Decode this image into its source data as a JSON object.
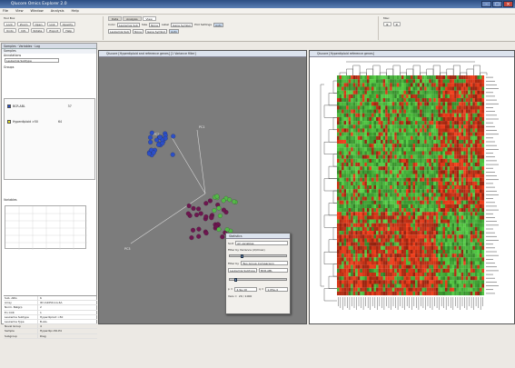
{
  "app": {
    "title": "Qlucore Omics Explorer 2.0"
  },
  "menu": [
    "File",
    "View",
    "Window",
    "Analysis",
    "Help"
  ],
  "toolbar": {
    "group1_label": "Tool Box",
    "buttons_row1": [
      "Lock",
      "Zoom",
      "Open",
      "Link",
      "Opacity"
    ],
    "buttons_row2": [
      "Undo",
      "Info",
      "Rotate",
      "Export",
      "Help"
    ],
    "tabs": [
      "Data",
      "Analysis",
      "View"
    ],
    "color_label": "Color",
    "color_value": "Leukemia Sub",
    "size_label": "Size",
    "size_value": "None",
    "label_label": "Label",
    "label_value": "Gene Symbol",
    "plot_label": "Plot Settings",
    "plot_value": "Auto",
    "misc_label": "Misc"
  },
  "left_panel": {
    "title": "Samples",
    "tabs": [
      "Samples",
      "Variables",
      "Log"
    ],
    "annotations_label": "Annotations",
    "annotation_value": "Leukemia Subtype",
    "legend_label": "Groups",
    "legend": [
      {
        "label": "BCR-ABL",
        "count": "37",
        "color": "#2850c8"
      },
      {
        "label": "Hyperdiploid >50",
        "count": "64",
        "color": "#e0e020"
      }
    ],
    "variables_label": "Variables",
    "properties": [
      [
        "Sub. ARG",
        "6"
      ],
      [
        "Array",
        "ID=A2050-1A-6A"
      ],
      [
        "Norm. Batgrp",
        "2"
      ],
      [
        "En CCR",
        "1"
      ],
      [
        "Leukemia Subtype",
        "Hyperdiploid >50"
      ],
      [
        "Leukemia Type",
        "B-ALL"
      ],
      [
        "Novel Group",
        "4"
      ],
      [
        "Sample",
        "Hyperdip>50-P4"
      ],
      [
        "Subgroup",
        "Diag"
      ]
    ]
  },
  "pca_window": {
    "title": "Qlucore [Hyperdiploid and reference genes] [1 Variance filter]",
    "axis_labels": [
      "PC1",
      "PC2",
      "PC3"
    ]
  },
  "heatmap_window": {
    "title": "Qlucore [Hyperdiploid reference genes]"
  },
  "filter_dialog": {
    "title": "Statistics",
    "sort_label": "Sort",
    "sort_value": "All variables",
    "filter1_label": "Filter by Variance (σ/σmax)",
    "filter2_label": "Filter by",
    "filter2_value": "Two Group Comparison",
    "group_a": "Leukemia Subtype",
    "group_b": "BCR-ABL",
    "p_label": "p =",
    "p_value": "4.9e-10",
    "q_label": "q =",
    "q_value": "1.05e-4",
    "vars_label": "Vars =",
    "vars_value": "29 / 1000"
  },
  "colors": {
    "blue_group": "#2c4fc8",
    "green_group": "#54b848",
    "purple_group": "#6e1650",
    "heat_red": "#e0401c",
    "heat_green": "#58b448"
  }
}
